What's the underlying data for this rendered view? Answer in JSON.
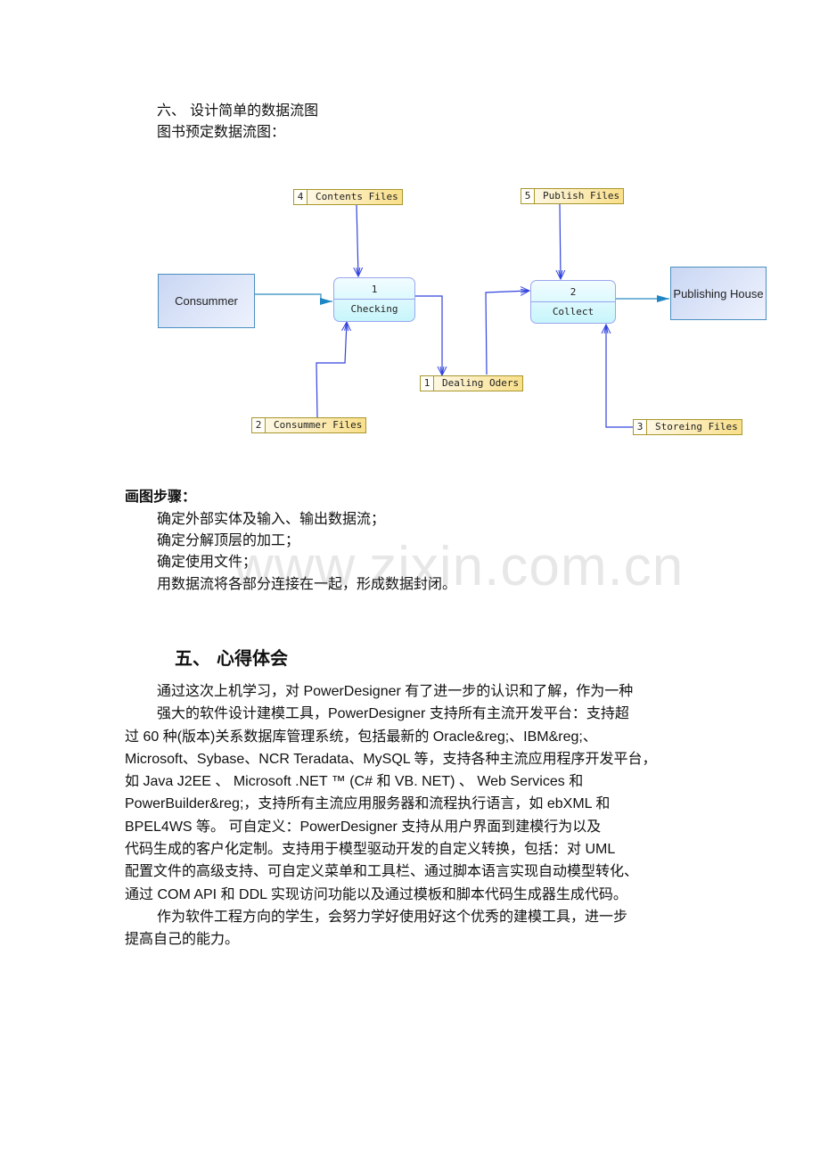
{
  "section6": {
    "heading": "六、  设计简单的数据流图",
    "subheading": "图书预定数据流图："
  },
  "diagram": {
    "entities": [
      {
        "id": "consummer",
        "label": "Consummer"
      },
      {
        "id": "publishing-house",
        "label": "Publishing House"
      }
    ],
    "processes": [
      {
        "id": "1",
        "name": "Checking"
      },
      {
        "id": "2",
        "name": "Collect"
      }
    ],
    "stores": [
      {
        "id": "4",
        "name": "Contents Files"
      },
      {
        "id": "5",
        "name": "Publish Files"
      },
      {
        "id": "1",
        "name": "Dealing Oders"
      },
      {
        "id": "2",
        "name": "Consummer Files"
      },
      {
        "id": "3",
        "name": "Storeing Files"
      }
    ],
    "colors": {
      "flow_line": "#3344dd",
      "entity_flow": "#2b8ac0",
      "arrowhead_fill": "#1f86c4"
    }
  },
  "steps": {
    "title": "画图步骤：",
    "items": [
      "确定外部实体及输入、输出数据流；",
      "确定分解顶层的加工；",
      "确定使用文件；",
      "用数据流将各部分连接在一起，形成数据封闭。"
    ]
  },
  "watermark": "www.zixin.com.cn",
  "section5": {
    "heading": "五、  心得体会",
    "paragraph1_lines": [
      "通过这次上机学习，对 PowerDesigner 有了进一步的认识和了解，作为一种",
      "强大的软件设计建模工具，PowerDesigner 支持所有主流开发平台：支持超",
      "过 60 种(版本)关系数据库管理系统，包括最新的 Oracle&reg;、IBM&reg;、",
      "Microsoft、Sybase、NCR Teradata、MySQL 等，支持各种主流应用程序开发平台，",
      "如 Java J2EE 、 Microsoft .NET ™ (C# 和 VB. NET) 、 Web Services 和",
      "PowerBuilder&reg;，支持所有主流应用服务器和流程执行语言，如 ebXML 和",
      "BPEL4WS 等。    可自定义：PowerDesigner 支持从用户界面到建模行为以及",
      "代码生成的客户化定制。支持用于模型驱动开发的自定义转换，包括：对 UML",
      "配置文件的高级支持、可自定义菜单和工具栏、通过脚本语言实现自动模型转化、",
      "通过 COM API 和 DDL 实现访问功能以及通过模板和脚本代码生成器生成代码。"
    ],
    "paragraph2_lines": [
      "作为软件工程方向的学生，会努力学好使用好这个优秀的建模工具，进一步",
      "提高自己的能力。"
    ]
  }
}
